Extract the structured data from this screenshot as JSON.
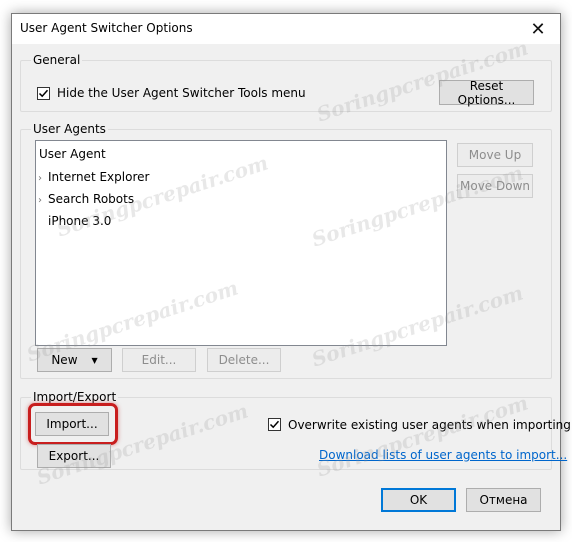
{
  "window": {
    "title": "User Agent Switcher Options",
    "close_glyph": "✕"
  },
  "general": {
    "label": "General",
    "hide_menu_label": "Hide the User Agent Switcher Tools menu",
    "hide_menu_checked": true,
    "reset_button": "Reset Options..."
  },
  "user_agents": {
    "label": "User Agents",
    "list_header": "User Agent",
    "items": [
      {
        "label": "Internet Explorer",
        "expandable": true
      },
      {
        "label": "Search Robots",
        "expandable": true
      },
      {
        "label": "iPhone 3.0",
        "expandable": false
      }
    ],
    "move_up": "Move Up",
    "move_down": "Move Down",
    "new_button": "New",
    "edit_button": "Edit...",
    "delete_button": "Delete..."
  },
  "import_export": {
    "label": "Import/Export",
    "import_button": "Import...",
    "export_button": "Export...",
    "overwrite_label": "Overwrite existing user agents when importing",
    "overwrite_checked": true,
    "download_link": "Download lists of user agents to import..."
  },
  "footer": {
    "ok_button": "OK",
    "cancel_button": "Отмена"
  },
  "watermark": {
    "text": "Soringpcrepair.com"
  },
  "colors": {
    "highlight": "#c81e1e",
    "link": "#0066cc",
    "default_button_border": "#0078d7"
  }
}
